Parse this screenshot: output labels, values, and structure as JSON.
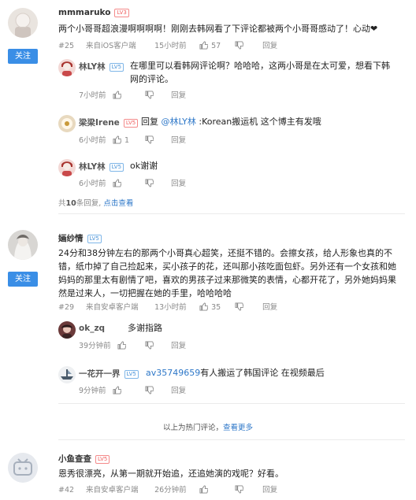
{
  "comments": [
    {
      "user": "mmmaruko",
      "level": "LV3",
      "follow_label": "关注",
      "text": "两个小哥哥超浪漫啊啊啊啊！刚刚去韩网看了下评论都被两个小哥哥感动了！心动❤",
      "floor": "#25",
      "source": "来自iOS客户端",
      "time": "15小时前",
      "likes": "57",
      "reply_label": "回复",
      "replies": [
        {
          "user": "林LY林",
          "level": "LV5",
          "text": "在哪里可以看韩网评论啊？哈哈哈，这两小哥是在太可爱，想看下韩网的评论。",
          "time": "7小时前",
          "likes": "",
          "reply_label": "回复"
        },
        {
          "user": "梁梁Irene",
          "level": "LV5",
          "reply_prefix": "回复",
          "mention": "@林LY林",
          "text": ":Korean搬运机 这个博主有发哦",
          "time": "6小时前",
          "likes": "1",
          "reply_label": "回复"
        },
        {
          "user": "林LY林",
          "level": "LV5",
          "text": "ok谢谢",
          "time": "6小时前",
          "likes": "",
          "reply_label": "回复"
        }
      ],
      "more_prefix": "共",
      "more_count": "10",
      "more_suffix": "条回复,",
      "more_link": "点击查看"
    },
    {
      "user": "婳纱情",
      "level": "LV5",
      "follow_label": "关注",
      "text": "24分和38分钟左右的那两个小哥真心超笑，还挺不错的。会擦女孩，给人形象也真的不错，纸巾掉了自己捡起来，买小孩子的花，还叫那小孩吃面包虾。另外还有一个女孩和她妈妈的那里太有剧情了吧，喜欢的男孩子过来那微笑的表情，心都开花了，另外她妈妈果然是过来人，一切把握在她的手里，哈哈哈哈",
      "floor": "#29",
      "source": "来自安卓客户端",
      "time": "13小时前",
      "likes": "35",
      "reply_label": "回复",
      "replies": [
        {
          "user": "ok_zq",
          "level": "",
          "text": "多谢指路",
          "time": "39分钟前",
          "likes": "",
          "reply_label": "回复"
        },
        {
          "user": "一花开一界",
          "level": "LV5",
          "mention": "av35749659",
          "text": "有人搬运了韩国评论 在视频最后",
          "time": "9分钟前",
          "likes": "",
          "reply_label": "回复"
        }
      ]
    },
    {
      "user": "小鱼查查",
      "level": "LV5",
      "text": "恩秀很漂亮，从第一期就开始追，还追她演的戏呢？好看。",
      "floor": "#42",
      "source": "来自安卓客户端",
      "time": "26分钟前",
      "likes": "",
      "reply_label": "回复"
    }
  ],
  "hot_footer": {
    "text": "以上为热门评论，",
    "link": "查看更多"
  },
  "icons": {
    "like": "thumbs-up-icon",
    "dislike": "thumbs-down-icon"
  },
  "colors": {
    "accent": "#3a8ee6",
    "link": "#2d77c8",
    "level_red": "#f06060",
    "level_blue": "#4a93d8"
  }
}
